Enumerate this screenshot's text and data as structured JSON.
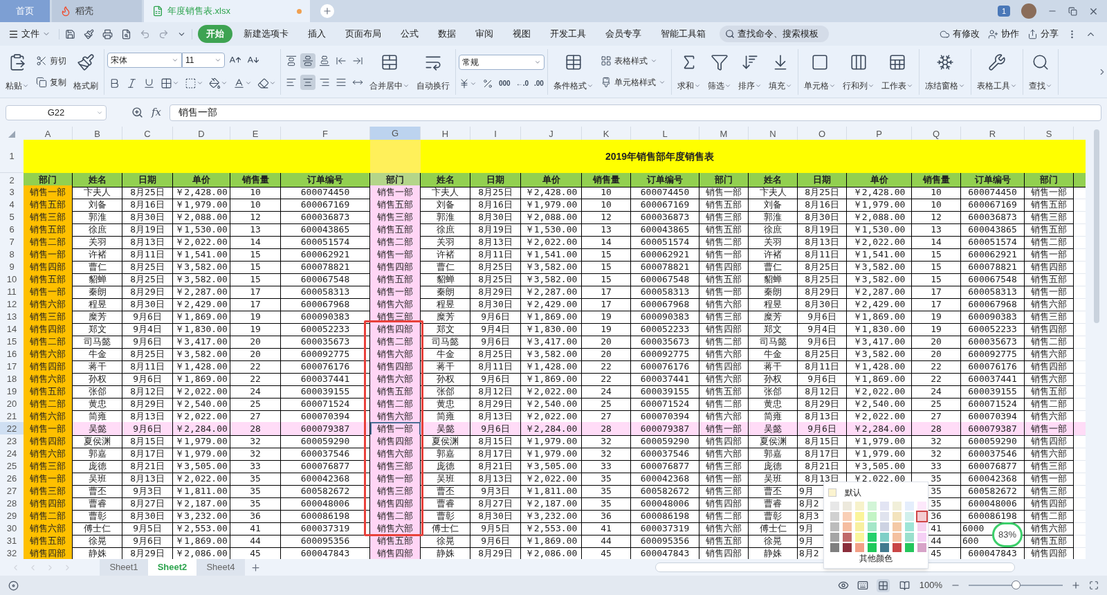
{
  "title_tabs": [
    {
      "label": "首页",
      "kind": "home",
      "selected": false,
      "unsaved": false
    },
    {
      "label": "稻壳",
      "kind": "docer",
      "selected": false,
      "unsaved": false
    },
    {
      "label": "年度销售表.xlsx",
      "kind": "sheet",
      "selected": true,
      "unsaved": true
    }
  ],
  "notice_badge": "1",
  "menu": {
    "file": "文件",
    "tabs": [
      {
        "label": "开始",
        "selected": true
      },
      {
        "label": "新建选项卡",
        "selected": false
      },
      {
        "label": "插入",
        "selected": false
      },
      {
        "label": "页面布局",
        "selected": false
      },
      {
        "label": "公式",
        "selected": false
      },
      {
        "label": "数据",
        "selected": false
      },
      {
        "label": "审阅",
        "selected": false
      },
      {
        "label": "视图",
        "selected": false
      },
      {
        "label": "开发工具",
        "selected": false
      },
      {
        "label": "会员专享",
        "selected": false
      },
      {
        "label": "智能工具箱",
        "selected": false
      }
    ],
    "search_placeholder": "查找命令、搜索模板",
    "actions": [
      "有修改",
      "协作",
      "分享"
    ]
  },
  "ribbon": [
    {
      "items": [
        {
          "kind": "large",
          "label": "粘贴",
          "dropdown": true
        },
        {
          "kind": "stack",
          "items": [
            {
              "label": "剪切",
              "dropdown": false
            },
            {
              "label": "复制",
              "dropdown": false
            }
          ]
        },
        {
          "kind": "large",
          "label": "格式刷",
          "dropdown": false
        }
      ]
    },
    {
      "items": [
        {
          "kind": "font",
          "font": "宋体",
          "size": "11",
          "top": [
            {
              "selected": false,
              "dropdown": false
            },
            {
              "selected": false,
              "dropdown": false
            }
          ],
          "bottom": [
            {
              "selected": false,
              "dropdown": false
            },
            {
              "selected": false,
              "dropdown": false
            },
            {
              "selected": false,
              "dropdown": false
            },
            {
              "selected": false,
              "dropdown": true
            },
            {
              "selected": false,
              "dropdown": true
            },
            {
              "selected": false,
              "dropdown": true
            },
            {
              "selected": false,
              "dropdown": true
            },
            {
              "selected": false,
              "dropdown": true
            }
          ]
        }
      ]
    },
    {
      "items": [
        {
          "kind": "icon_grid",
          "rows": [
            [
              {
                "selected": false
              },
              {
                "selected": true
              },
              {
                "selected": false
              },
              {
                "selected": false
              },
              {
                "selected": false
              }
            ],
            [
              {
                "selected": false
              },
              {
                "selected": true
              },
              {
                "selected": false
              },
              {
                "selected": false
              },
              {
                "selected": false
              }
            ]
          ]
        },
        {
          "kind": "large",
          "label": "合并居中",
          "dropdown": true
        },
        {
          "kind": "large",
          "label": "自动换行",
          "dropdown": false
        }
      ]
    },
    {
      "items": [
        {
          "kind": "number",
          "format": "常规",
          "bottom": [
            {
              "kind": "icon",
              "dropdown": true
            },
            {
              "kind": "icon",
              "dropdown": false
            },
            {
              "kind": "text",
              "text": "000"
            },
            {
              "kind": "text",
              "text": "←.0"
            },
            {
              "kind": "text",
              "text": ".00"
            }
          ]
        }
      ]
    },
    {
      "items": [
        {
          "kind": "large",
          "label": "条件格式",
          "dropdown": true
        },
        {
          "kind": "stack",
          "items": [
            {
              "label": "表格样式",
              "dropdown": true
            },
            {
              "label": "单元格样式",
              "dropdown": true
            }
          ]
        }
      ]
    },
    {
      "items": [
        {
          "kind": "large",
          "label": "求和",
          "dropdown": true
        },
        {
          "kind": "large",
          "label": "筛选",
          "dropdown": true
        },
        {
          "kind": "large",
          "label": "排序",
          "dropdown": true
        },
        {
          "kind": "large",
          "label": "填充",
          "dropdown": true
        }
      ]
    },
    {
      "items": [
        {
          "kind": "large",
          "label": "单元格",
          "dropdown": true
        },
        {
          "kind": "large",
          "label": "行和列",
          "dropdown": true
        },
        {
          "kind": "large",
          "label": "工作表",
          "dropdown": true
        }
      ]
    },
    {
      "items": [
        {
          "kind": "large",
          "label": "冻结窗格",
          "dropdown": true
        }
      ]
    },
    {
      "items": [
        {
          "kind": "large",
          "label": "表格工具",
          "dropdown": true
        }
      ]
    },
    {
      "items": [
        {
          "kind": "large",
          "label": "查找",
          "dropdown": true
        }
      ]
    }
  ],
  "formula_bar": {
    "name_box": "G22",
    "fx_label": "fx",
    "formula": "销售一部"
  },
  "grid": {
    "columns": [
      {
        "label": "A",
        "selected": false,
        "color": "#ffc000"
      },
      {
        "label": "B",
        "selected": false
      },
      {
        "label": "C",
        "selected": false
      },
      {
        "label": "D",
        "selected": false
      },
      {
        "label": "E",
        "selected": false
      },
      {
        "label": "F",
        "selected": false
      },
      {
        "label": "G",
        "selected": true,
        "color": "#ffd5f5"
      },
      {
        "label": "H",
        "selected": false
      },
      {
        "label": "I",
        "selected": false
      },
      {
        "label": "J",
        "selected": false
      },
      {
        "label": "K",
        "selected": false
      },
      {
        "label": "L",
        "selected": false
      },
      {
        "label": "M",
        "selected": false
      },
      {
        "label": "N",
        "selected": false
      },
      {
        "label": "O",
        "selected": false
      },
      {
        "label": "P",
        "selected": false
      },
      {
        "label": "Q",
        "selected": false
      },
      {
        "label": "R",
        "selected": false
      },
      {
        "label": "S",
        "selected": false
      }
    ],
    "title_row": {
      "num": "1",
      "title": "2019年销售部年度销售表"
    },
    "header_row": {
      "num": "2",
      "cells": [
        "部门",
        "姓名",
        "日期",
        "单价",
        "销售量",
        "订单编号",
        "部门",
        "姓名",
        "日期",
        "单价",
        "销售量",
        "订单编号",
        "部门",
        "姓名",
        "日期",
        "单价",
        "销售量",
        "订单编号",
        "部门"
      ]
    },
    "rows": [
      {
        "num": "3",
        "selected": false,
        "cells": [
          "销售一部",
          "卞夫人",
          "8月25日",
          "￥2,428.00",
          "10",
          "600074450",
          "销售一部",
          "卞夫人",
          "8月25日",
          "￥2,428.00",
          "10",
          "600074450",
          "销售一部",
          "卞夫人",
          "8月25日",
          "￥2,428.00",
          "10",
          "600074450",
          "销售一部"
        ]
      },
      {
        "num": "4",
        "selected": false,
        "cells": [
          "销售五部",
          "刘备",
          "8月16日",
          "￥1,979.00",
          "10",
          "600067169",
          "销售五部",
          "刘备",
          "8月16日",
          "￥1,979.00",
          "10",
          "600067169",
          "销售五部",
          "刘备",
          "8月16日",
          "￥1,979.00",
          "10",
          "600067169",
          "销售五部"
        ]
      },
      {
        "num": "5",
        "selected": false,
        "cells": [
          "销售三部",
          "郭淮",
          "8月30日",
          "￥2,088.00",
          "12",
          "600036873",
          "销售三部",
          "郭淮",
          "8月30日",
          "￥2,088.00",
          "12",
          "600036873",
          "销售三部",
          "郭淮",
          "8月30日",
          "￥2,088.00",
          "12",
          "600036873",
          "销售三部"
        ]
      },
      {
        "num": "6",
        "selected": false,
        "cells": [
          "销售五部",
          "徐庶",
          "8月19日",
          "￥1,530.00",
          "13",
          "600043865",
          "销售五部",
          "徐庶",
          "8月19日",
          "￥1,530.00",
          "13",
          "600043865",
          "销售五部",
          "徐庶",
          "8月19日",
          "￥1,530.00",
          "13",
          "600043865",
          "销售五部"
        ]
      },
      {
        "num": "7",
        "selected": false,
        "cells": [
          "销售二部",
          "关羽",
          "8月13日",
          "￥2,022.00",
          "14",
          "600051574",
          "销售二部",
          "关羽",
          "8月13日",
          "￥2,022.00",
          "14",
          "600051574",
          "销售二部",
          "关羽",
          "8月13日",
          "￥2,022.00",
          "14",
          "600051574",
          "销售二部"
        ]
      },
      {
        "num": "8",
        "selected": false,
        "cells": [
          "销售一部",
          "许褚",
          "8月11日",
          "￥1,541.00",
          "15",
          "600062921",
          "销售一部",
          "许褚",
          "8月11日",
          "￥1,541.00",
          "15",
          "600062921",
          "销售一部",
          "许褚",
          "8月11日",
          "￥1,541.00",
          "15",
          "600062921",
          "销售一部"
        ]
      },
      {
        "num": "9",
        "selected": false,
        "cells": [
          "销售四部",
          "曹仁",
          "8月25日",
          "￥3,582.00",
          "15",
          "600078821",
          "销售四部",
          "曹仁",
          "8月25日",
          "￥3,582.00",
          "15",
          "600078821",
          "销售四部",
          "曹仁",
          "8月25日",
          "￥3,582.00",
          "15",
          "600078821",
          "销售四部"
        ]
      },
      {
        "num": "10",
        "selected": false,
        "cells": [
          "销售五部",
          "貂蝉",
          "8月25日",
          "￥3,582.00",
          "15",
          "600067548",
          "销售五部",
          "貂蝉",
          "8月25日",
          "￥3,582.00",
          "15",
          "600067548",
          "销售五部",
          "貂蝉",
          "8月25日",
          "￥3,582.00",
          "15",
          "600067548",
          "销售五部"
        ]
      },
      {
        "num": "11",
        "selected": false,
        "cells": [
          "销售一部",
          "秦朗",
          "8月29日",
          "￥2,287.00",
          "17",
          "600058313",
          "销售一部",
          "秦朗",
          "8月29日",
          "￥2,287.00",
          "17",
          "600058313",
          "销售一部",
          "秦朗",
          "8月29日",
          "￥2,287.00",
          "17",
          "600058313",
          "销售一部"
        ]
      },
      {
        "num": "12",
        "selected": false,
        "cells": [
          "销售六部",
          "程昱",
          "8月30日",
          "￥2,429.00",
          "17",
          "600067968",
          "销售六部",
          "程昱",
          "8月30日",
          "￥2,429.00",
          "17",
          "600067968",
          "销售六部",
          "程昱",
          "8月30日",
          "￥2,429.00",
          "17",
          "600067968",
          "销售六部"
        ]
      },
      {
        "num": "13",
        "selected": false,
        "cells": [
          "销售三部",
          "糜芳",
          "9月6日",
          "￥1,869.00",
          "19",
          "600090383",
          "销售三部",
          "糜芳",
          "9月6日",
          "￥1,869.00",
          "19",
          "600090383",
          "销售三部",
          "糜芳",
          "9月6日",
          "￥1,869.00",
          "19",
          "600090383",
          "销售三部"
        ]
      },
      {
        "num": "14",
        "selected": false,
        "cells": [
          "销售四部",
          "郑文",
          "9月4日",
          "￥1,830.00",
          "19",
          "600052233",
          "销售四部",
          "郑文",
          "9月4日",
          "￥1,830.00",
          "19",
          "600052233",
          "销售四部",
          "郑文",
          "9月4日",
          "￥1,830.00",
          "19",
          "600052233",
          "销售四部"
        ]
      },
      {
        "num": "15",
        "selected": false,
        "cells": [
          "销售二部",
          "司马懿",
          "9月6日",
          "￥3,417.00",
          "20",
          "600035673",
          "销售二部",
          "司马懿",
          "9月6日",
          "￥3,417.00",
          "20",
          "600035673",
          "销售二部",
          "司马懿",
          "9月6日",
          "￥3,417.00",
          "20",
          "600035673",
          "销售二部"
        ]
      },
      {
        "num": "16",
        "selected": false,
        "cells": [
          "销售六部",
          "牛金",
          "8月25日",
          "￥3,582.00",
          "20",
          "600092775",
          "销售六部",
          "牛金",
          "8月25日",
          "￥3,582.00",
          "20",
          "600092775",
          "销售六部",
          "牛金",
          "8月25日",
          "￥3,582.00",
          "20",
          "600092775",
          "销售六部"
        ]
      },
      {
        "num": "17",
        "selected": false,
        "cells": [
          "销售四部",
          "蒋干",
          "8月11日",
          "￥1,428.00",
          "22",
          "600076176",
          "销售四部",
          "蒋干",
          "8月11日",
          "￥1,428.00",
          "22",
          "600076176",
          "销售四部",
          "蒋干",
          "8月11日",
          "￥1,428.00",
          "22",
          "600076176",
          "销售四部"
        ]
      },
      {
        "num": "18",
        "selected": false,
        "cells": [
          "销售六部",
          "孙权",
          "9月6日",
          "￥1,869.00",
          "22",
          "600037441",
          "销售六部",
          "孙权",
          "9月6日",
          "￥1,869.00",
          "22",
          "600037441",
          "销售六部",
          "孙权",
          "9月6日",
          "￥1,869.00",
          "22",
          "600037441",
          "销售六部"
        ]
      },
      {
        "num": "19",
        "selected": false,
        "cells": [
          "销售五部",
          "张郃",
          "8月12日",
          "￥2,022.00",
          "24",
          "600039155",
          "销售五部",
          "张郃",
          "8月12日",
          "￥2,022.00",
          "24",
          "600039155",
          "销售五部",
          "张郃",
          "8月12日",
          "￥2,022.00",
          "24",
          "600039155",
          "销售五部"
        ]
      },
      {
        "num": "20",
        "selected": false,
        "cells": [
          "销售二部",
          "黄忠",
          "8月29日",
          "￥2,540.00",
          "25",
          "600071524",
          "销售二部",
          "黄忠",
          "8月29日",
          "￥2,540.00",
          "25",
          "600071524",
          "销售二部",
          "黄忠",
          "8月29日",
          "￥2,540.00",
          "25",
          "600071524",
          "销售二部"
        ]
      },
      {
        "num": "21",
        "selected": false,
        "cells": [
          "销售六部",
          "简雍",
          "8月13日",
          "￥2,022.00",
          "27",
          "600070394",
          "销售六部",
          "简雍",
          "8月13日",
          "￥2,022.00",
          "27",
          "600070394",
          "销售六部",
          "简雍",
          "8月13日",
          "￥2,022.00",
          "27",
          "600070394",
          "销售六部"
        ]
      },
      {
        "num": "22",
        "selected": true,
        "cells": [
          "销售一部",
          "吴懿",
          "9月6日",
          "￥2,284.00",
          "28",
          "600079387",
          "销售一部",
          "吴懿",
          "9月6日",
          "￥2,284.00",
          "28",
          "600079387",
          "销售一部",
          "吴懿",
          "9月6日",
          "￥2,284.00",
          "28",
          "600079387",
          "销售一部"
        ]
      },
      {
        "num": "23",
        "selected": false,
        "cells": [
          "销售四部",
          "夏侯渊",
          "8月15日",
          "￥1,979.00",
          "32",
          "600059290",
          "销售四部",
          "夏侯渊",
          "8月15日",
          "￥1,979.00",
          "32",
          "600059290",
          "销售四部",
          "夏侯渊",
          "8月15日",
          "￥1,979.00",
          "32",
          "600059290",
          "销售四部"
        ]
      },
      {
        "num": "24",
        "selected": false,
        "cells": [
          "销售六部",
          "郭嘉",
          "8月17日",
          "￥1,979.00",
          "32",
          "600037546",
          "销售六部",
          "郭嘉",
          "8月17日",
          "￥1,979.00",
          "32",
          "600037546",
          "销售六部",
          "郭嘉",
          "8月17日",
          "￥1,979.00",
          "32",
          "600037546",
          "销售六部"
        ]
      },
      {
        "num": "25",
        "selected": false,
        "cells": [
          "销售三部",
          "庞德",
          "8月21日",
          "￥3,505.00",
          "33",
          "600076877",
          "销售三部",
          "庞德",
          "8月21日",
          "￥3,505.00",
          "33",
          "600076877",
          "销售三部",
          "庞德",
          "8月21日",
          "￥3,505.00",
          "33",
          "600076877",
          "销售三部"
        ]
      },
      {
        "num": "26",
        "selected": false,
        "cells": [
          "销售一部",
          "吴班",
          "8月13日",
          "￥2,022.00",
          "35",
          "600042368",
          "销售一部",
          "吴班",
          "8月13日",
          "￥2,022.00",
          "35",
          "600042368",
          "销售一部",
          "吴班",
          "8月13日",
          "￥2,022.00",
          "35",
          "600042368",
          "销售一部"
        ]
      },
      {
        "num": "27",
        "selected": false,
        "cells": [
          "销售三部",
          "曹丕",
          "9月3日",
          "￥1,811.00",
          "35",
          "600582672",
          "销售三部",
          "曹丕",
          "9月3日",
          "￥1,811.00",
          "35",
          "600582672",
          "销售三部",
          "曹丕",
          {
            "text": "9月",
            "cut": true
          },
          null,
          "35",
          "600582672",
          "销售三部"
        ]
      },
      {
        "num": "28",
        "selected": false,
        "cells": [
          "销售四部",
          "曹睿",
          "8月27日",
          "￥2,187.00",
          "35",
          "600048006",
          "销售四部",
          "曹睿",
          "8月27日",
          "￥2,187.00",
          "35",
          "600048006",
          "销售四部",
          "曹睿",
          {
            "text": "8月2",
            "cut": true
          },
          null,
          "35",
          "600048006",
          "销售四部"
        ]
      },
      {
        "num": "29",
        "selected": false,
        "cells": [
          "销售二部",
          "曹彰",
          "8月30日",
          "￥3,232.00",
          "36",
          "600086198",
          "销售二部",
          "曹彰",
          "8月30日",
          "￥3,232.00",
          "36",
          "600086198",
          "销售二部",
          "曹彰",
          {
            "text": "8月3",
            "cut": true
          },
          null,
          "36",
          "600086198",
          "销售二部"
        ]
      },
      {
        "num": "30",
        "selected": false,
        "cells": [
          "销售六部",
          "傅士仁",
          "9月5日",
          "￥2,553.00",
          "41",
          "600037319",
          "销售六部",
          "傅士仁",
          "9月5日",
          "￥2,553.00",
          "41",
          "600037319",
          "销售六部",
          "傅士仁",
          {
            "text": "9月",
            "cut": true
          },
          null,
          "41",
          {
            "text": "6000",
            "cut": true
          },
          "销售六部"
        ]
      },
      {
        "num": "31",
        "selected": false,
        "cells": [
          "销售五部",
          "徐晃",
          "9月6日",
          "￥1,869.00",
          "44",
          "600095356",
          "销售五部",
          "徐晃",
          "9月6日",
          "￥1,869.00",
          "44",
          "600095356",
          "销售五部",
          "徐晃",
          {
            "text": "9月",
            "cut": true
          },
          null,
          "44",
          {
            "text": "600",
            "cut": true
          },
          "销售五部"
        ]
      },
      {
        "num": "32",
        "selected": false,
        "cells": [
          "销售四部",
          "静姝",
          "8月29日",
          "￥2,086.00",
          "45",
          "600047843",
          "销售四部",
          "静姝",
          "8月29日",
          "￥2,086.00",
          "45",
          "600047843",
          "销售四部",
          "静姝",
          {
            "text": "8月2",
            "cut": true
          },
          null,
          "45",
          "600047843",
          "销售四部"
        ]
      }
    ]
  },
  "color_popup": {
    "default_label": "默认",
    "more_label": "其他颜色"
  },
  "speed_ball": {
    "percent": "83%"
  },
  "sheet_tabs": [
    {
      "label": "Sheet1",
      "selected": false
    },
    {
      "label": "Sheet2",
      "selected": true
    },
    {
      "label": "Sheet4",
      "selected": false
    }
  ],
  "status_bar": {
    "zoom": "100%",
    "zoom_slider": {
      "level": 0.5
    },
    "views": [
      {
        "kind": "normal",
        "selected": true
      },
      {
        "kind": "page",
        "selected": false
      }
    ]
  }
}
